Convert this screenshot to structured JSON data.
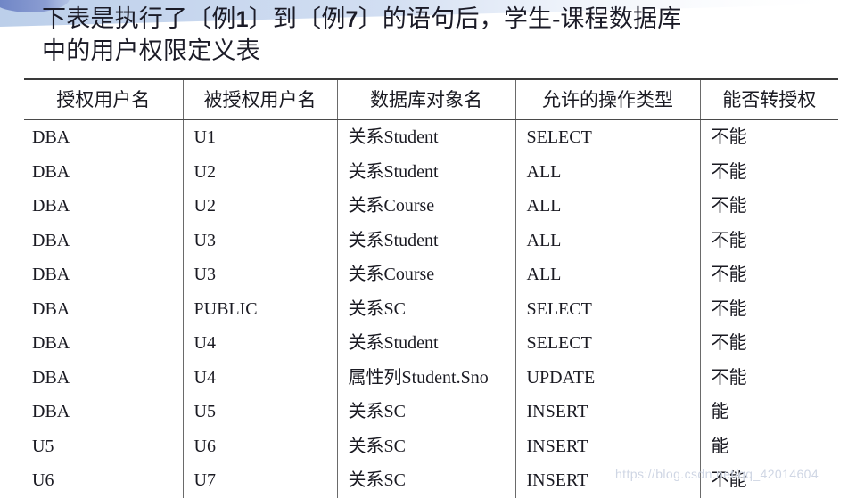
{
  "slide": {
    "title": "下表是执行了〔例1〕到〔例7〕的语句后，学生-课程数据库\n中的用户权限定义表",
    "watermark": "https://blog.csdn.net/qq_42014604"
  },
  "colors": {
    "deco_dark_blue": "#6b82c4",
    "deco_light_blue": "#c3d3ec",
    "text": "#1a1a22",
    "rule": "#3a3a3a"
  },
  "table": {
    "headers": [
      "授权用户名",
      "被授权用户名",
      "数据库对象名",
      "允许的操作类型",
      "能否转授权"
    ],
    "rows": [
      [
        "DBA",
        "U1",
        "关系Student",
        "SELECT",
        "不能"
      ],
      [
        "DBA",
        "U2",
        "关系Student",
        "ALL",
        "不能"
      ],
      [
        "DBA",
        "U2",
        "关系Course",
        "ALL",
        "不能"
      ],
      [
        "DBA",
        "U3",
        "关系Student",
        "ALL",
        "不能"
      ],
      [
        "DBA",
        "U3",
        "关系Course",
        "ALL",
        "不能"
      ],
      [
        "DBA",
        "PUBLIC",
        "关系SC",
        "SELECT",
        "不能"
      ],
      [
        "DBA",
        "U4",
        "关系Student",
        "SELECT",
        "不能"
      ],
      [
        "DBA",
        "U4",
        "属性列Student.Sno",
        "UPDATE",
        "不能"
      ],
      [
        "DBA",
        "U5",
        "关系SC",
        "INSERT",
        "能"
      ],
      [
        "U5",
        "U6",
        "关系SC",
        "INSERT",
        "能"
      ],
      [
        "U6",
        "U7",
        "关系SC",
        "INSERT",
        "不能"
      ]
    ]
  }
}
